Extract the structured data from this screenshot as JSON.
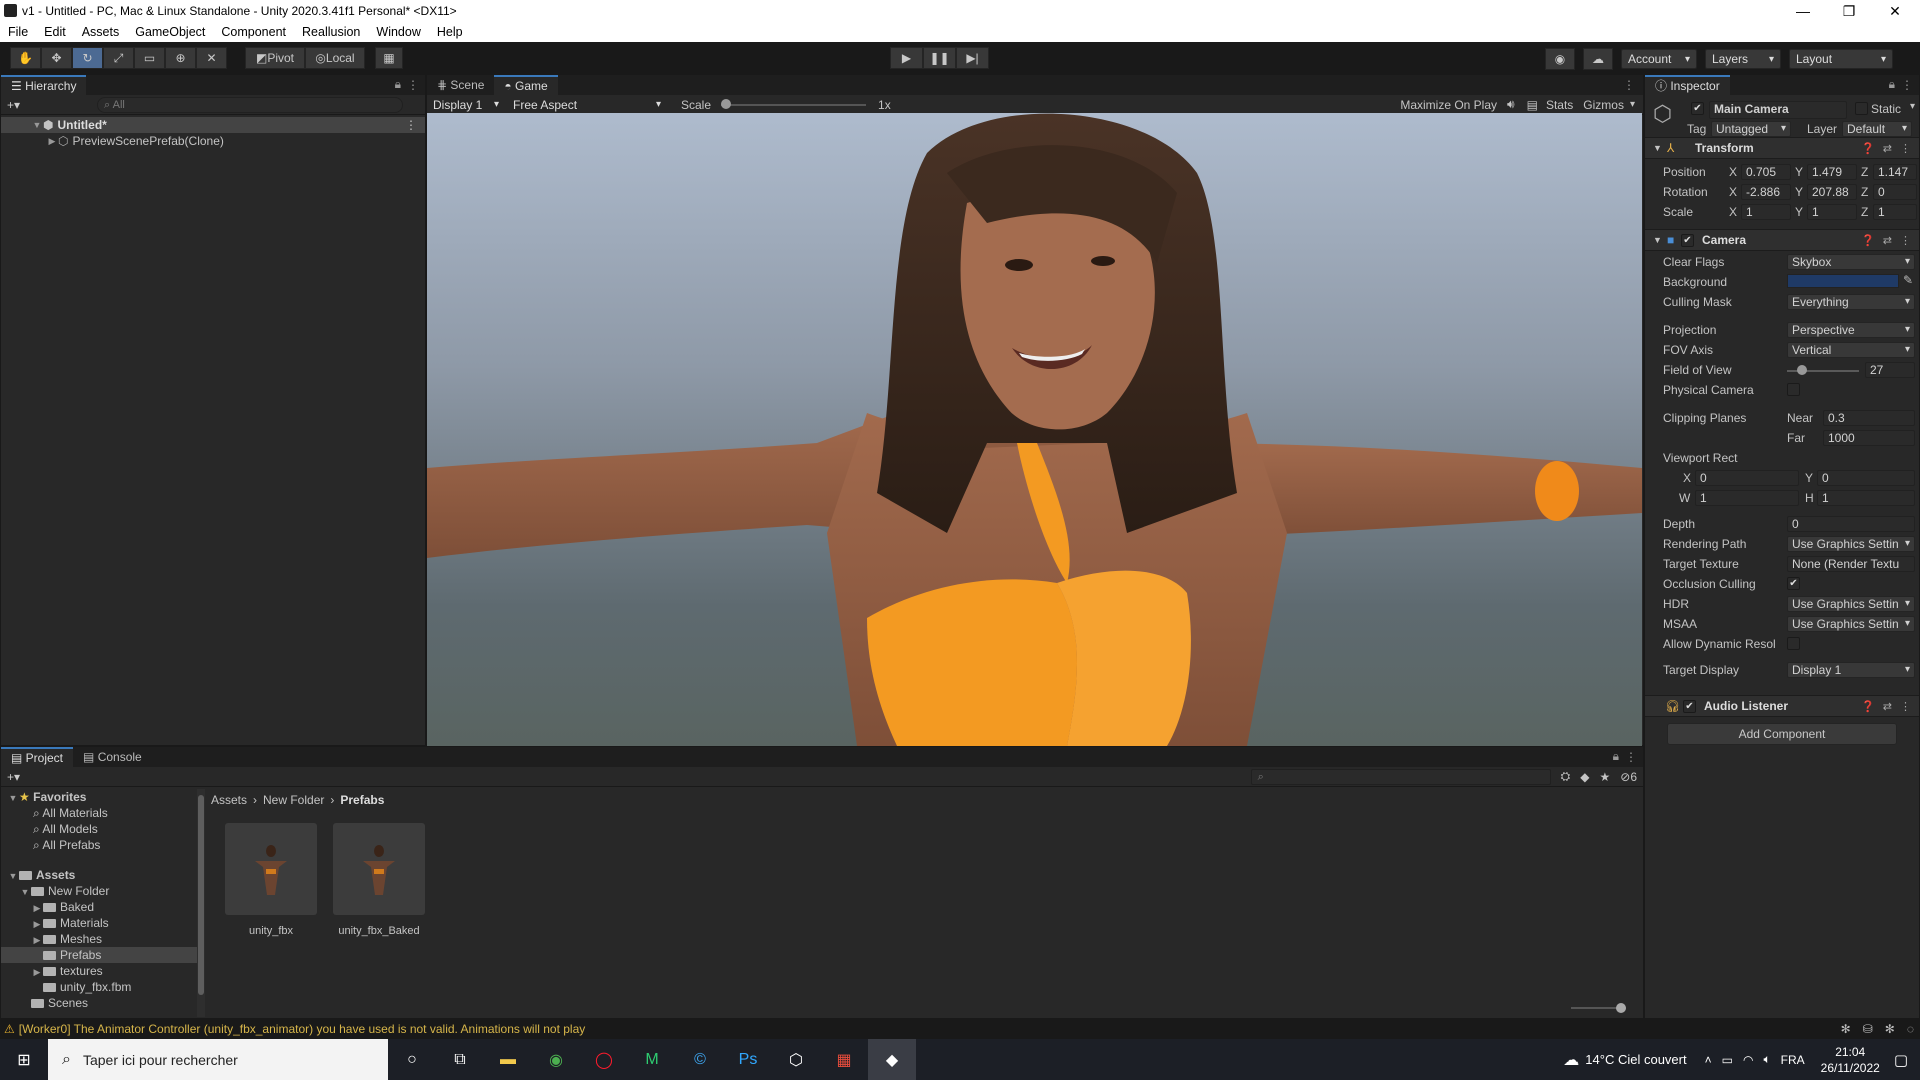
{
  "window": {
    "title": "v1 - Untitled - PC, Mac & Linux Standalone - Unity 2020.3.41f1 Personal* <DX11>",
    "minimize": "—",
    "maximize": "❐",
    "close": "✕"
  },
  "menu": [
    "File",
    "Edit",
    "Assets",
    "GameObject",
    "Component",
    "Reallusion",
    "Window",
    "Help"
  ],
  "toolbar": {
    "pivot": "Pivot",
    "local": "Local",
    "account": "Account",
    "layers": "Layers",
    "layout": "Layout"
  },
  "hierarchy": {
    "tab": "Hierarchy",
    "search_placeholder": "All",
    "scene": "Untitled*",
    "items": [
      "PreviewScenePrefab(Clone)"
    ]
  },
  "game": {
    "tabs": [
      "Scene",
      "Game"
    ],
    "display": "Display 1",
    "aspect": "Free Aspect",
    "scale_label": "Scale",
    "scale_value": 0.0,
    "scale_text": "1x",
    "maximize": "Maximize On Play",
    "stats": "Stats",
    "gizmos": "Gizmos"
  },
  "inspector": {
    "tab": "Inspector",
    "object_name": "Main Camera",
    "static": "Static",
    "tag_label": "Tag",
    "tag": "Untagged",
    "layer_label": "Layer",
    "layer": "Default",
    "transform": {
      "title": "Transform",
      "position_label": "Position",
      "rotation_label": "Rotation",
      "scale_label": "Scale",
      "position": {
        "x": "0.705",
        "y": "1.479",
        "z": "1.147"
      },
      "rotation": {
        "x": "-2.886",
        "y": "207.88",
        "z": "0"
      },
      "scale": {
        "x": "1",
        "y": "1",
        "z": "1"
      }
    },
    "camera": {
      "title": "Camera",
      "clear_flags_label": "Clear Flags",
      "clear_flags": "Skybox",
      "background_label": "Background",
      "background_color": "#1f3a66",
      "culling_label": "Culling Mask",
      "culling": "Everything",
      "projection_label": "Projection",
      "projection": "Perspective",
      "fov_axis_label": "FOV Axis",
      "fov_axis": "Vertical",
      "fov_label": "Field of View",
      "fov": "27",
      "physical_label": "Physical Camera",
      "clipping_label": "Clipping Planes",
      "near_label": "Near",
      "near": "0.3",
      "far_label": "Far",
      "far": "1000",
      "viewport_label": "Viewport Rect",
      "vx": "0",
      "vy": "0",
      "vw": "1",
      "vh": "1",
      "depth_label": "Depth",
      "depth": "0",
      "rendering_label": "Rendering Path",
      "rendering": "Use Graphics Settin",
      "target_texture_label": "Target Texture",
      "target_texture": "None (Render Textu",
      "occlusion_label": "Occlusion Culling",
      "hdr_label": "HDR",
      "hdr": "Use Graphics Settin",
      "msaa_label": "MSAA",
      "msaa": "Use Graphics Settin",
      "dynres_label": "Allow Dynamic Resol",
      "target_display_label": "Target Display",
      "target_display": "Display 1"
    },
    "audio_listener": "Audio Listener",
    "add_component": "Add Component"
  },
  "project": {
    "tabs": [
      "Project",
      "Console"
    ],
    "favorites": "Favorites",
    "fav_items": [
      "All Materials",
      "All Models",
      "All Prefabs"
    ],
    "assets": "Assets",
    "folders": [
      {
        "name": "New Folder",
        "depth": 1,
        "open": true
      },
      {
        "name": "Baked",
        "depth": 2
      },
      {
        "name": "Materials",
        "depth": 2
      },
      {
        "name": "Meshes",
        "depth": 2
      },
      {
        "name": "Prefabs",
        "depth": 2,
        "selected": true
      },
      {
        "name": "textures",
        "depth": 2
      },
      {
        "name": "unity_fbx.fbm",
        "depth": 2
      },
      {
        "name": "Scenes",
        "depth": 1
      }
    ],
    "breadcrumb": [
      "Assets",
      "New Folder",
      "Prefabs"
    ],
    "items": [
      "unity_fbx",
      "unity_fbx_Baked"
    ],
    "hidden_count": "6"
  },
  "status": {
    "message": "[Worker0] The Animator Controller (unity_fbx_animator) you have used is not valid. Animations will not play"
  },
  "taskbar": {
    "search": "Taper ici pour rechercher",
    "weather": "14°C  Ciel couvert",
    "lang": "FRA",
    "time": "21:04",
    "date": "26/11/2022"
  }
}
